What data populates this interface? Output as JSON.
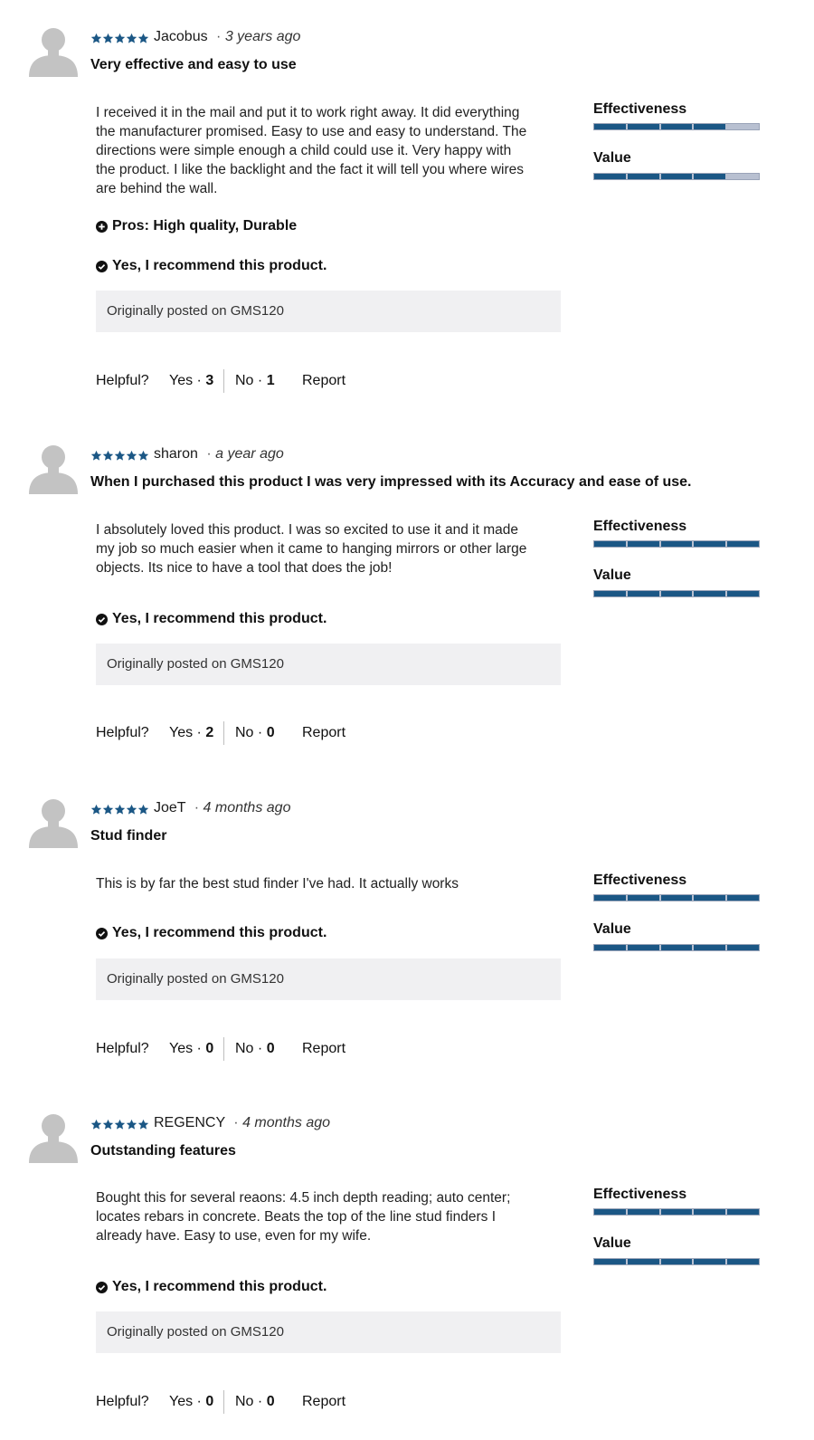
{
  "colors": {
    "star": "#1b5785",
    "bar_fill": "#1b5785",
    "bar_empty": "#b8c0d1",
    "origin_bg": "#f0f0f2",
    "avatar": "#c3c3c3"
  },
  "labels": {
    "helpful": "Helpful?",
    "yes": "Yes ·",
    "no": "No ·",
    "report": "Report",
    "effectiveness": "Effectiveness",
    "value": "Value",
    "recommend": "Yes, I recommend this product.",
    "origin": "Originally posted on GMS120"
  },
  "reviews": [
    {
      "stars": 5,
      "author": "Jacobus",
      "when": "3 years ago",
      "title": "Very effective and easy to use",
      "body_lines": [
        "I received it in the mail and put it to work right away. It did everything",
        "the manufacturer promised. Easy to use and easy to understand. The",
        "directions were simple enough a child could use it. Very happy with",
        "the product. I like the backlight and the fact it will tell you where wires",
        "are behind the wall."
      ],
      "pros": "Pros: High quality, Durable",
      "effectiveness": 4,
      "value": 4,
      "rating_max": 5,
      "helpful_yes": "3",
      "helpful_no": "1"
    },
    {
      "stars": 5,
      "author": "sharon",
      "when": "a year ago",
      "title": "When I purchased this product I was very impressed with its Accuracy and ease of use.",
      "body_lines": [
        "I absolutely loved this product. I was so excited to use it and it made",
        "my job so much easier when it came to hanging mirrors or other large",
        "objects. Its nice to have a tool that does the job!"
      ],
      "pros": null,
      "effectiveness": 5,
      "value": 5,
      "rating_max": 5,
      "helpful_yes": "2",
      "helpful_no": "0"
    },
    {
      "stars": 5,
      "author": "JoeT",
      "when": "4 months ago",
      "title": "Stud finder",
      "body_lines": [
        "This is by far the best stud finder I've had. It actually works"
      ],
      "pros": null,
      "effectiveness": 5,
      "value": 5,
      "rating_max": 5,
      "helpful_yes": "0",
      "helpful_no": "0"
    },
    {
      "stars": 5,
      "author": "REGENCY",
      "when": "4 months ago",
      "title": "Outstanding features",
      "body_lines": [
        "Bought this for several reaons: 4.5 inch depth reading; auto center;",
        "locates rebars in concrete. Beats the top of the line stud finders I",
        "already have. Easy to use, even for my wife."
      ],
      "pros": null,
      "effectiveness": 5,
      "value": 5,
      "rating_max": 5,
      "helpful_yes": "0",
      "helpful_no": "0"
    }
  ]
}
